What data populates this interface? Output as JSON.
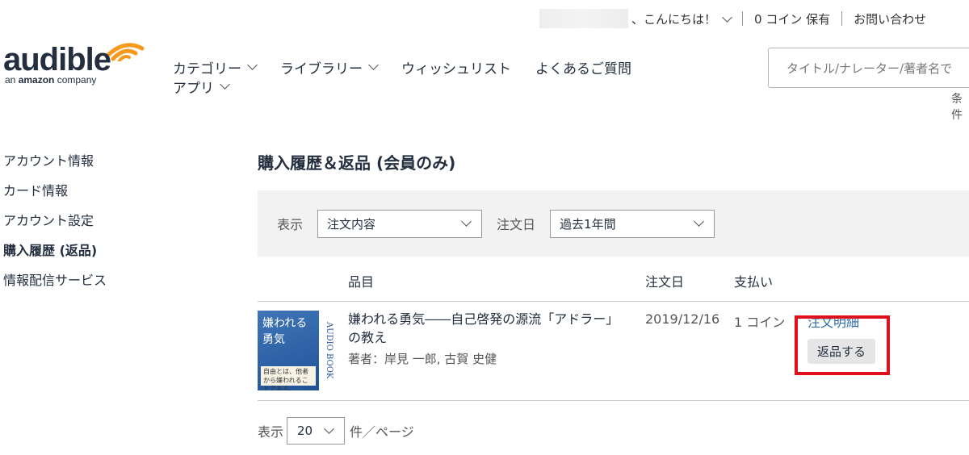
{
  "header": {
    "greeting": "、こんにちは！",
    "coins": "0 コイン 保有",
    "contact": "お問い合わせ",
    "search_placeholder": "タイトル/ナレーター/著者名で",
    "search_conditions": "条件"
  },
  "logo": {
    "word": "audible",
    "sub_prefix": "an ",
    "sub_brand": "amazon",
    "sub_suffix": " company"
  },
  "nav": {
    "row1": [
      "カテゴリー",
      "ライブラリー",
      "ウィッシュリスト",
      "よくあるご質問"
    ],
    "row2": [
      "アプリ"
    ]
  },
  "sidebar": {
    "items": [
      "アカウント情報",
      "カード情報",
      "アカウント設定",
      "購入履歴 (返品)",
      "情報配信サービス"
    ]
  },
  "page_title": "購入履歴＆返品 (会員のみ)",
  "filter": {
    "display_label": "表示",
    "display_value": "注文内容",
    "date_label": "注文日",
    "date_value": "過去1年間"
  },
  "table": {
    "headers": {
      "item": "品目",
      "date": "注文日",
      "payment": "支払い"
    },
    "rows": [
      {
        "title": "嫌われる勇気――自己啓発の源流「アドラー」の教え",
        "author": "著者：岸見 一郎, 古賀 史健",
        "date": "2019/12/16",
        "payment": "1 コイン",
        "detail_link": "注文明細",
        "return_button": "返品する",
        "cover_title": "嫌われる勇気",
        "cover_spine": "AUDIO BOOK",
        "cover_band_text": "自由とは、他者から嫌われることである。"
      }
    ]
  },
  "paging": {
    "prefix": "表示",
    "value": "20",
    "suffix": "件／ページ"
  },
  "colors": {
    "highlight": "#e0101a",
    "logo_orange": "#f7991c",
    "link": "#2e6ea6"
  }
}
